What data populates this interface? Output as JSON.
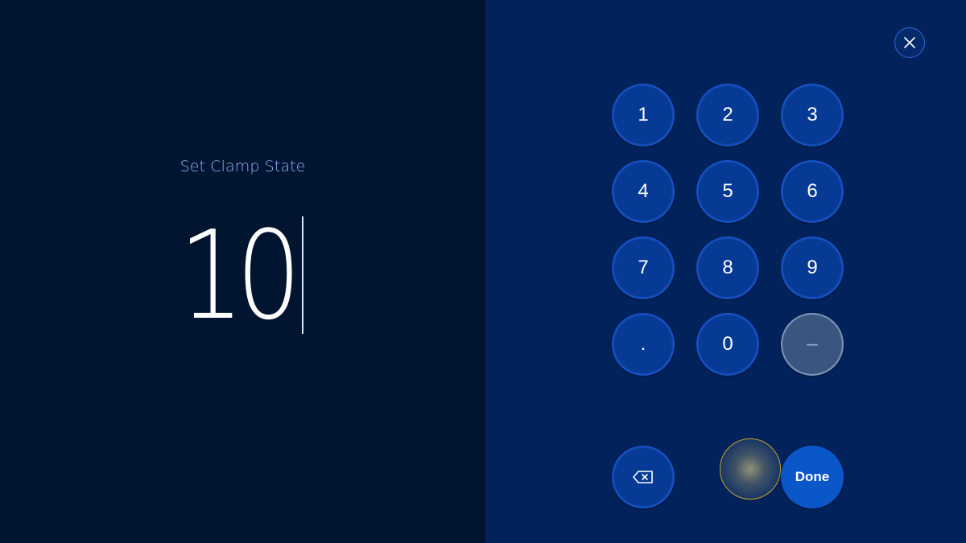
{
  "dialog": {
    "prompt_label": "Set Clamp State",
    "current_value": "10",
    "close_icon": "close-icon"
  },
  "keypad": {
    "keys": [
      {
        "label": "1"
      },
      {
        "label": "2"
      },
      {
        "label": "3"
      },
      {
        "label": "4"
      },
      {
        "label": "5"
      },
      {
        "label": "6"
      },
      {
        "label": "7"
      },
      {
        "label": "8"
      },
      {
        "label": "9"
      },
      {
        "label": "."
      },
      {
        "label": "0"
      },
      {
        "label": "–"
      }
    ],
    "backspace_icon": "backspace-icon",
    "done_label": "Done"
  },
  "colors": {
    "left_background": "#011530",
    "right_background": "#01225a",
    "key_fill": "#063a94",
    "key_border": "#1651c7",
    "done_fill": "#0b56c9",
    "label_color": "#8fb3ff",
    "press_indicator_ring": "#c9a52a"
  }
}
